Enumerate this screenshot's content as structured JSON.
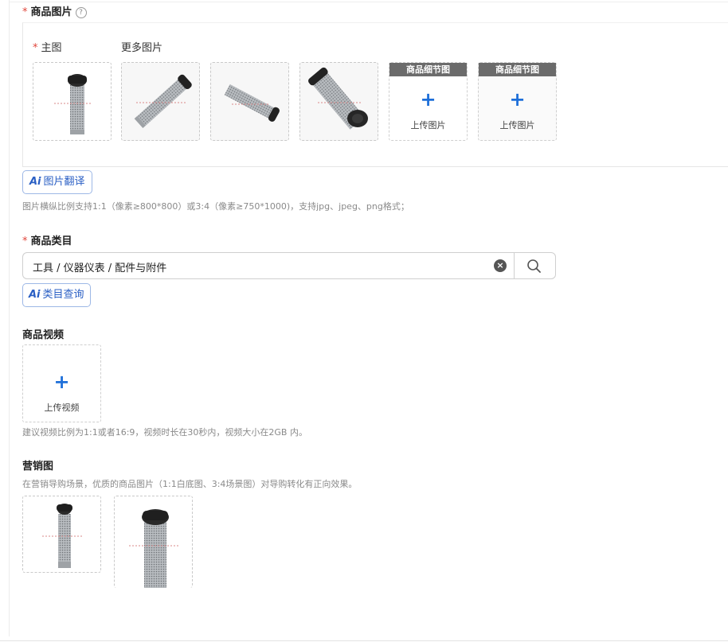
{
  "product_images": {
    "required_mark": "*",
    "label": "商品图片",
    "help_icon": "?",
    "main_label": "主图",
    "more_label": "更多图片",
    "detail_badge": "商品细节图",
    "upload_plus": "+",
    "upload_text": "上传图片",
    "ai_logo": "Ai",
    "translate_label": "图片翻译",
    "hint": "图片横纵比例支持1:1（像素≥800*800）或3:4（像素≥750*1000)，支持jpg、jpeg、png格式；"
  },
  "category": {
    "required_mark": "*",
    "label": "商品类目",
    "value": "工具 / 仪器仪表 / 配件与附件",
    "clear_icon": "×",
    "ai_logo": "Ai",
    "ai_button_label": "类目查询"
  },
  "video": {
    "label": "商品视频",
    "upload_plus": "+",
    "upload_text": "上传视频",
    "hint": "建议视频比例为1:1或者16:9，视频时长在30秒内，视频大小在2GB 内。"
  },
  "marketing": {
    "label": "营销图",
    "hint": "在营销导购场景，优质的商品图片（1:1白底图、3:4场景图）对导购转化有正向效果。"
  },
  "colors": {
    "accent": "#1e6fd9",
    "required": "#e0453b",
    "ai_text": "#2a5fc4",
    "badge_bg": "#6b6b6b"
  }
}
